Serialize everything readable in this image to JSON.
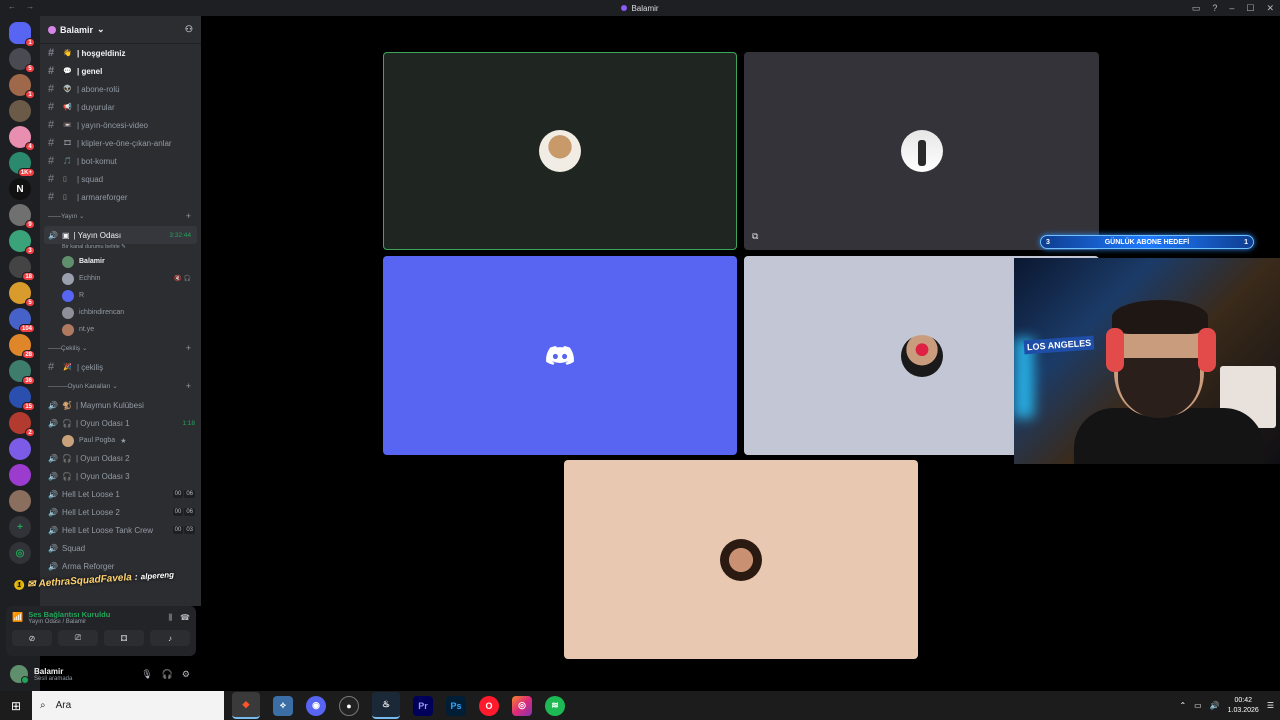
{
  "window": {
    "title": "Balamir",
    "nav": "← →"
  },
  "servers": [
    {
      "icon": "discord-home",
      "badge": "1",
      "color": "#5865f2"
    },
    {
      "icon": "server",
      "badge": "5",
      "color": "#4a4a52"
    },
    {
      "icon": "server",
      "badge": "1",
      "color": "#a0684a"
    },
    {
      "icon": "server",
      "badge": "",
      "color": "#6b5a48"
    },
    {
      "icon": "server",
      "badge": "4",
      "color": "#e88fb0"
    },
    {
      "icon": "server",
      "badge": "1K+",
      "color": "#2b8a6e"
    },
    {
      "icon": "server",
      "badge": "",
      "color": "#111111",
      "label": "N"
    },
    {
      "icon": "server",
      "badge": "9",
      "color": "#707070"
    },
    {
      "icon": "server",
      "badge": "3",
      "color": "#3aa37a"
    },
    {
      "icon": "server",
      "badge": "18",
      "color": "#444444"
    },
    {
      "icon": "server",
      "badge": "5",
      "color": "#d99b2b"
    },
    {
      "icon": "server",
      "badge": "104",
      "color": "#4662c8"
    },
    {
      "icon": "server",
      "badge": "28",
      "color": "#e0862a"
    },
    {
      "icon": "server",
      "badge": "36",
      "color": "#3e7c6b"
    },
    {
      "icon": "server",
      "badge": "15",
      "color": "#2a4fae"
    },
    {
      "icon": "server",
      "badge": "2",
      "color": "#b33a2e"
    },
    {
      "icon": "server",
      "badge": "",
      "color": "#7c5ce6"
    },
    {
      "icon": "server",
      "badge": "",
      "color": "#9b3ccf"
    },
    {
      "icon": "server",
      "badge": "",
      "color": "#8a6e5e"
    }
  ],
  "guild": {
    "name": "Balamir"
  },
  "text_channels": [
    {
      "emoji": "👋",
      "name": "| hoşgeldiniz",
      "unread": true
    },
    {
      "emoji": "💬",
      "name": "| genel",
      "unread": true
    },
    {
      "emoji": "👽",
      "name": "| abone-rolü",
      "unread": false
    },
    {
      "emoji": "📢",
      "name": "| duyurular",
      "unread": false
    },
    {
      "emoji": "📼",
      "name": "| yayın-öncesi-video",
      "unread": false
    },
    {
      "emoji": "🎞",
      "name": "| klipler-ve-öne-çıkan-anlar",
      "unread": false
    },
    {
      "emoji": "🎵",
      "name": "| bot-komut",
      "unread": false
    },
    {
      "emoji": "▯",
      "name": "| squad",
      "unread": false
    },
    {
      "emoji": "▯",
      "name": "| armareforger",
      "unread": false
    }
  ],
  "cat_yayin": "Yayın",
  "yayin_odasi": {
    "name": "| Yayın Odası",
    "time": "3:32:44",
    "status": "Bir kanal durumu belirle ✎"
  },
  "members": [
    {
      "name": "Balamir",
      "me": true,
      "color": "#5f8f6c",
      "icons": ""
    },
    {
      "name": "Echhin",
      "me": false,
      "color": "#9aa0ad",
      "icons": "🔇 🎧"
    },
    {
      "name": "R",
      "me": false,
      "color": "#5865f2",
      "icons": ""
    },
    {
      "name": "ichbindirencan",
      "me": false,
      "color": "#8f8f99",
      "icons": ""
    },
    {
      "name": "nt.ye",
      "me": false,
      "color": "#b07a60",
      "icons": ""
    }
  ],
  "cat_cekilis": "Çekiliş",
  "cekilis": {
    "emoji": "🎉",
    "name": "| çekiliş"
  },
  "cat_oyun": "Oyun Kanalları",
  "maymun": "| Maymun Kulübesi",
  "oyun1": {
    "name": "| Oyun Odası 1",
    "time": "1:18"
  },
  "oyun1_member": "Paul Pogba",
  "oyun2": "| Oyun Odası 2",
  "oyun3": "| Oyun Odası 3",
  "hll": [
    {
      "name": "Hell Let Loose 1",
      "a": "00",
      "b": "06"
    },
    {
      "name": "Hell Let Loose 2",
      "a": "00",
      "b": "06"
    },
    {
      "name": "Hell Let Loose Tank Crew",
      "a": "00",
      "b": "03"
    }
  ],
  "squad": "Squad",
  "arma": "Arma Reforger",
  "overlay": {
    "num": "1",
    "name": "AethraSquadFavela",
    "sep": ":",
    "user": "alpereng"
  },
  "voice_panel": {
    "title": "Ses Bağlantısı Kuruldu",
    "sub": "Yayın Odası / Balamir"
  },
  "user": {
    "name": "Balamir",
    "status": "Sesli aramada"
  },
  "goal": {
    "left": "3",
    "label": "GÜNLÜK ABONE HEDEFİ",
    "right": "1"
  },
  "camera_sign": "LOS ANGELES",
  "taskbar": {
    "search_placeholder": "Ara",
    "time": "00:42",
    "date": "1.03.2026"
  }
}
